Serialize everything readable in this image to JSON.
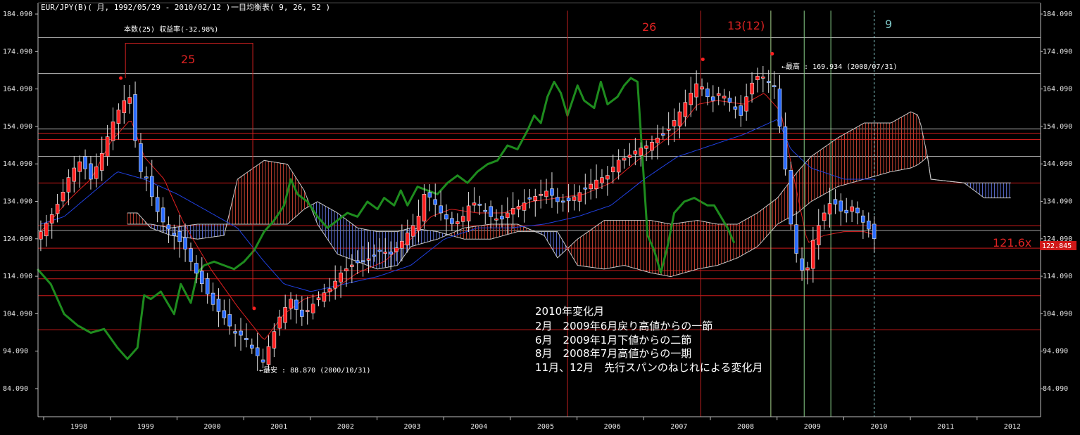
{
  "header": {
    "title": "EUR/JPY(B)( 月, 1992/05/29 - 2010/02/12 )",
    "indicator": "一目均衡表( 9, 26, 52 )"
  },
  "colors": {
    "candle_up": "#ff2020",
    "candle_down": "#2a6bff",
    "tenkan": "#e02020",
    "kijun": "#2040e0",
    "chikou": "#1e8c1e",
    "span_line": "#c8c8c8",
    "cloud_red": "#c04030",
    "cloud_blue": "#5a6cd0",
    "hline_red": "#cc1a1a",
    "hline_white": "#d8d8d8",
    "vline_red": "#c02020",
    "vline_green": "#8ad08a",
    "vline_cyan": "#90d8d8"
  },
  "chart_data": {
    "type": "candlestick",
    "x_tick_labels": [
      "1998",
      "1999",
      "2000",
      "2001",
      "2002",
      "2003",
      "2004",
      "2005",
      "2006",
      "2007",
      "2008",
      "2009",
      "2010",
      "2011",
      "2012"
    ],
    "y_tick_labels": [
      "184.090",
      "174.090",
      "164.090",
      "154.090",
      "144.090",
      "134.090",
      "124.090",
      "114.090",
      "104.090",
      "94.090",
      "84.090"
    ],
    "y_ticks": [
      184.09,
      174.09,
      164.09,
      154.09,
      144.09,
      134.09,
      124.09,
      114.09,
      104.09,
      94.09,
      84.09
    ],
    "current_price_label": "122.845",
    "current_price": 122.845,
    "target_label": "121.6x",
    "annotations": {
      "high": "←最高 : 169.934 (2008/07/31)",
      "low": "←最安 : 88.870 (2000/10/31)",
      "count_box": "本数(25) 収益率(-32.98%)",
      "count_25": "25",
      "count_26": "26",
      "count_13": "13(12)",
      "count_9": "9"
    },
    "notes": [
      "2010年変化月",
      "2月　2009年6月戻り高値からの一節",
      "6月　2009年1月下値からの二節",
      "8月　2008年7月高値からの一期",
      "11月、12月　先行スパンのねじれによる変化月"
    ],
    "red_hlines": [
      152.3,
      150.6,
      139.0,
      127.6,
      121.6,
      115.6,
      113.4,
      108.9,
      99.8
    ],
    "white_hlines": [
      177.8,
      168.2,
      153.4,
      146.1,
      126.3
    ],
    "vlines": [
      {
        "x": 2005.35,
        "color": "red",
        "top": 185.0
      },
      {
        "x": 2007.35,
        "color": "red",
        "top": 185.0
      },
      {
        "x": 2008.4,
        "color": "red",
        "top": 185.0
      },
      {
        "x": 2008.4,
        "color": "green",
        "top": 185.0
      },
      {
        "x": 2008.9,
        "color": "green",
        "top": 185.0
      },
      {
        "x": 2009.3,
        "color": "green",
        "top": 185.0
      },
      {
        "x": 2009.95,
        "color": "cyan_dotted",
        "top": 185.0
      }
    ],
    "candles_anchor": [
      [
        1997.45,
        126
      ],
      [
        1997.6,
        130
      ],
      [
        1997.75,
        135
      ],
      [
        1997.9,
        142
      ],
      [
        1998.05,
        145
      ],
      [
        1998.2,
        140
      ],
      [
        1998.35,
        146
      ],
      [
        1998.5,
        154
      ],
      [
        1998.6,
        158
      ],
      [
        1998.7,
        161
      ],
      [
        1998.8,
        162
      ],
      [
        1998.88,
        148
      ],
      [
        1998.95,
        142
      ],
      [
        1999.05,
        140
      ],
      [
        1999.15,
        133
      ],
      [
        1999.3,
        128
      ],
      [
        1999.45,
        125
      ],
      [
        1999.6,
        122
      ],
      [
        1999.75,
        116
      ],
      [
        1999.9,
        111
      ],
      [
        2000.05,
        106
      ],
      [
        2000.2,
        103
      ],
      [
        2000.35,
        99
      ],
      [
        2000.5,
        98
      ],
      [
        2000.65,
        94
      ],
      [
        2000.78,
        91
      ],
      [
        2000.9,
        97
      ],
      [
        2001.05,
        104
      ],
      [
        2001.2,
        108
      ],
      [
        2001.35,
        103
      ],
      [
        2001.5,
        106
      ],
      [
        2001.65,
        109
      ],
      [
        2001.8,
        111
      ],
      [
        2001.95,
        115
      ],
      [
        2002.1,
        117
      ],
      [
        2002.25,
        118
      ],
      [
        2002.4,
        119
      ],
      [
        2002.55,
        121
      ],
      [
        2002.7,
        120
      ],
      [
        2002.85,
        123
      ],
      [
        2003.0,
        127
      ],
      [
        2003.1,
        129
      ],
      [
        2003.2,
        136
      ],
      [
        2003.3,
        135
      ],
      [
        2003.45,
        131
      ],
      [
        2003.6,
        128
      ],
      [
        2003.75,
        129
      ],
      [
        2003.9,
        134
      ],
      [
        2004.05,
        133
      ],
      [
        2004.2,
        130
      ],
      [
        2004.35,
        129
      ],
      [
        2004.5,
        132
      ],
      [
        2004.65,
        133
      ],
      [
        2004.8,
        135
      ],
      [
        2004.95,
        136
      ],
      [
        2005.05,
        137
      ],
      [
        2005.2,
        134
      ],
      [
        2005.35,
        134
      ],
      [
        2005.5,
        136
      ],
      [
        2005.65,
        138
      ],
      [
        2005.8,
        140
      ],
      [
        2005.95,
        141
      ],
      [
        2006.1,
        145
      ],
      [
        2006.25,
        146
      ],
      [
        2006.4,
        148
      ],
      [
        2006.55,
        149
      ],
      [
        2006.7,
        151
      ],
      [
        2006.85,
        153
      ],
      [
        2007.0,
        157
      ],
      [
        2007.1,
        160
      ],
      [
        2007.2,
        163
      ],
      [
        2007.3,
        166
      ],
      [
        2007.4,
        164
      ],
      [
        2007.5,
        160
      ],
      [
        2007.6,
        163
      ],
      [
        2007.72,
        162
      ],
      [
        2007.85,
        159
      ],
      [
        2007.95,
        157
      ],
      [
        2008.05,
        163
      ],
      [
        2008.15,
        167
      ],
      [
        2008.25,
        168
      ],
      [
        2008.35,
        166
      ],
      [
        2008.45,
        165
      ],
      [
        2008.55,
        152
      ],
      [
        2008.65,
        138
      ],
      [
        2008.72,
        124
      ],
      [
        2008.82,
        118
      ],
      [
        2008.92,
        113
      ],
      [
        2009.0,
        122
      ],
      [
        2009.1,
        127
      ],
      [
        2009.2,
        131
      ],
      [
        2009.3,
        134
      ],
      [
        2009.4,
        133
      ],
      [
        2009.5,
        130
      ],
      [
        2009.6,
        133
      ],
      [
        2009.7,
        131
      ],
      [
        2009.8,
        128
      ],
      [
        2009.9,
        126
      ],
      [
        2009.98,
        123
      ]
    ],
    "chikou_anchor": [
      [
        1997.4,
        116
      ],
      [
        1997.6,
        112
      ],
      [
        1997.8,
        104
      ],
      [
        1998.0,
        101
      ],
      [
        1998.2,
        99
      ],
      [
        1998.4,
        100
      ],
      [
        1998.6,
        95
      ],
      [
        1998.75,
        92
      ],
      [
        1998.9,
        95
      ],
      [
        1999.0,
        109
      ],
      [
        1999.1,
        108
      ],
      [
        1999.25,
        110
      ],
      [
        1999.35,
        107
      ],
      [
        1999.45,
        104
      ],
      [
        1999.55,
        112
      ],
      [
        1999.7,
        107
      ],
      [
        1999.8,
        115
      ],
      [
        1999.9,
        117
      ],
      [
        2000.05,
        118
      ],
      [
        2000.2,
        117
      ],
      [
        2000.35,
        116
      ],
      [
        2000.5,
        118
      ],
      [
        2000.65,
        121
      ],
      [
        2000.8,
        126
      ],
      [
        2000.95,
        129
      ],
      [
        2001.1,
        133
      ],
      [
        2001.2,
        140
      ],
      [
        2001.3,
        136
      ],
      [
        2001.45,
        134
      ],
      [
        2001.6,
        130
      ],
      [
        2001.75,
        127
      ],
      [
        2001.9,
        129
      ],
      [
        2002.05,
        131
      ],
      [
        2002.2,
        130
      ],
      [
        2002.35,
        134
      ],
      [
        2002.5,
        132
      ],
      [
        2002.6,
        135
      ],
      [
        2002.75,
        133
      ],
      [
        2002.85,
        137
      ],
      [
        2002.95,
        133
      ],
      [
        2003.1,
        138
      ],
      [
        2003.25,
        137
      ],
      [
        2003.4,
        136
      ],
      [
        2003.55,
        139
      ],
      [
        2003.7,
        141
      ],
      [
        2003.85,
        139
      ],
      [
        2004.0,
        142
      ],
      [
        2004.15,
        144
      ],
      [
        2004.3,
        145
      ],
      [
        2004.45,
        149
      ],
      [
        2004.6,
        148
      ],
      [
        2004.75,
        153
      ],
      [
        2004.85,
        157
      ],
      [
        2004.95,
        155
      ],
      [
        2005.05,
        162
      ],
      [
        2005.15,
        166
      ],
      [
        2005.25,
        163
      ],
      [
        2005.35,
        157
      ],
      [
        2005.5,
        165
      ],
      [
        2005.6,
        161
      ],
      [
        2005.75,
        159
      ],
      [
        2005.85,
        166
      ],
      [
        2005.95,
        160
      ],
      [
        2006.1,
        162
      ],
      [
        2006.2,
        165
      ],
      [
        2006.3,
        167
      ],
      [
        2006.4,
        166
      ],
      [
        2006.55,
        125
      ],
      [
        2006.65,
        121
      ],
      [
        2006.75,
        115
      ],
      [
        2006.85,
        122
      ],
      [
        2006.95,
        131
      ],
      [
        2007.1,
        134
      ],
      [
        2007.25,
        135
      ],
      [
        2007.35,
        134
      ],
      [
        2007.45,
        133
      ],
      [
        2007.55,
        133
      ],
      [
        2007.65,
        130
      ],
      [
        2007.75,
        127
      ],
      [
        2007.85,
        123
      ]
    ]
  }
}
